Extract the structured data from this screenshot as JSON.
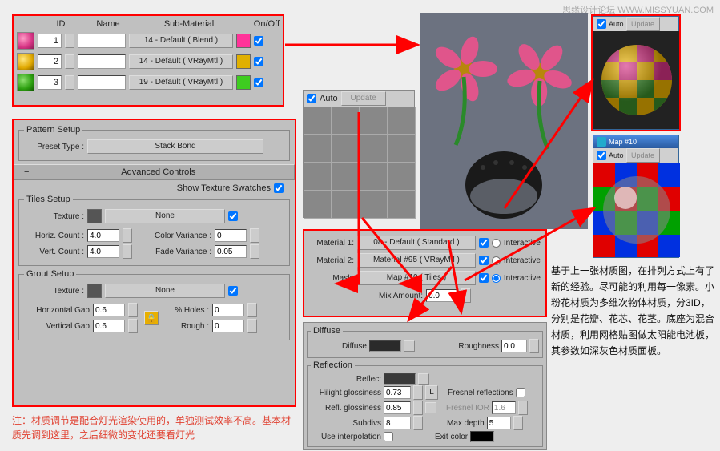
{
  "watermark": "思缘设计论坛  WWW.MISSYUAN.COM",
  "sublist": {
    "headers": {
      "id": "ID",
      "name": "Name",
      "sub": "Sub-Material",
      "onoff": "On/Off"
    },
    "rows": [
      {
        "id": "1",
        "sub": "14 - Default  ( Blend )",
        "color": "#ff3399",
        "swatch": "radial-gradient(circle at 35% 35%, #ff9ec7, #d63384 60%, #8a1f54)"
      },
      {
        "id": "2",
        "sub": "14 - Default  ( VRayMtl )",
        "color": "#e0b000",
        "swatch": "radial-gradient(circle at 35% 35%, #ffe680, #e0a800 60%, #7a5a00)"
      },
      {
        "id": "3",
        "sub": "19 - Default  ( VRayMtl )",
        "color": "#3ecc20",
        "swatch": "radial-gradient(circle at 35% 35%, #8fe070, #2da010 60%, #105a00)"
      }
    ]
  },
  "pattern": {
    "legend": "Pattern Setup",
    "presetLabel": "Preset Type :",
    "preset": "Stack Bond",
    "adv": "Advanced Controls",
    "showSwatch": "Show Texture Swatches",
    "tiles": {
      "legend": "Tiles Setup",
      "texture": "Texture :",
      "none": "None",
      "hcount": "Horiz. Count :",
      "hcv": "4.0",
      "vcount": "Vert. Count :",
      "vcv": "4.0",
      "cvar": "Color Variance :",
      "cvv": "0",
      "fvar": "Fade Variance :",
      "fvv": "0.05"
    },
    "grout": {
      "legend": "Grout Setup",
      "texture": "Texture :",
      "none": "None",
      "hgap": "Horizontal Gap",
      "hgv": "0.6",
      "vgap": "Vertical Gap",
      "vgv": "0.6",
      "holes": "% Holes :",
      "hv": "0",
      "rough": "Rough :",
      "rv": "0"
    }
  },
  "tilewin": {
    "auto": "Auto",
    "update": "Update"
  },
  "blend": {
    "m1": "Material 1:",
    "m1v": "08 - Default  ( Standard )",
    "m2": "Material 2:",
    "m2v": "Material #95 ( VRayMtl )",
    "mask": "Mask:",
    "maskv": "Map #10 ( Tiles )",
    "inter": "Interactive",
    "mix": "Mix Amount:",
    "mixv": "0.0"
  },
  "matparams": {
    "diffuse": "Diffuse",
    "diffuseLbl": "Diffuse",
    "rough": "Roughness",
    "roughv": "0.0",
    "refl": "Reflection",
    "reflect": "Reflect",
    "hg": "Hilight glossiness",
    "hgv": "0.73",
    "L": "L",
    "rg": "Refl. glossiness",
    "rgv": "0.85",
    "sub": "Subdivs",
    "subv": "8",
    "ui": "Use interpolation",
    "fr": "Fresnel reflections",
    "fior": "Fresnel IOR",
    "fiorv": "1.6",
    "md": "Max depth",
    "mdv": "5",
    "ec": "Exit color"
  },
  "prev1": {
    "auto": "Auto",
    "update": "Update"
  },
  "prev2": {
    "title": "Map #10",
    "auto": "Auto",
    "update": "Update"
  },
  "text": "基于上一张材质图，在排列方式上有了新的经验。尽可能的利用每一像素。小粉花材质为多维次物体材质，分3ID，分别是花瓣、花芯、花茎。底座为混合材质，利用网格贴图做太阳能电池板，其参数如深灰色材质面板。",
  "footnote": "注：材质调节是配合灯光渲染使用的，单独测试效率不高。基本材质先调到这里，之后细微的变化还要看灯光",
  "chart_data": null
}
